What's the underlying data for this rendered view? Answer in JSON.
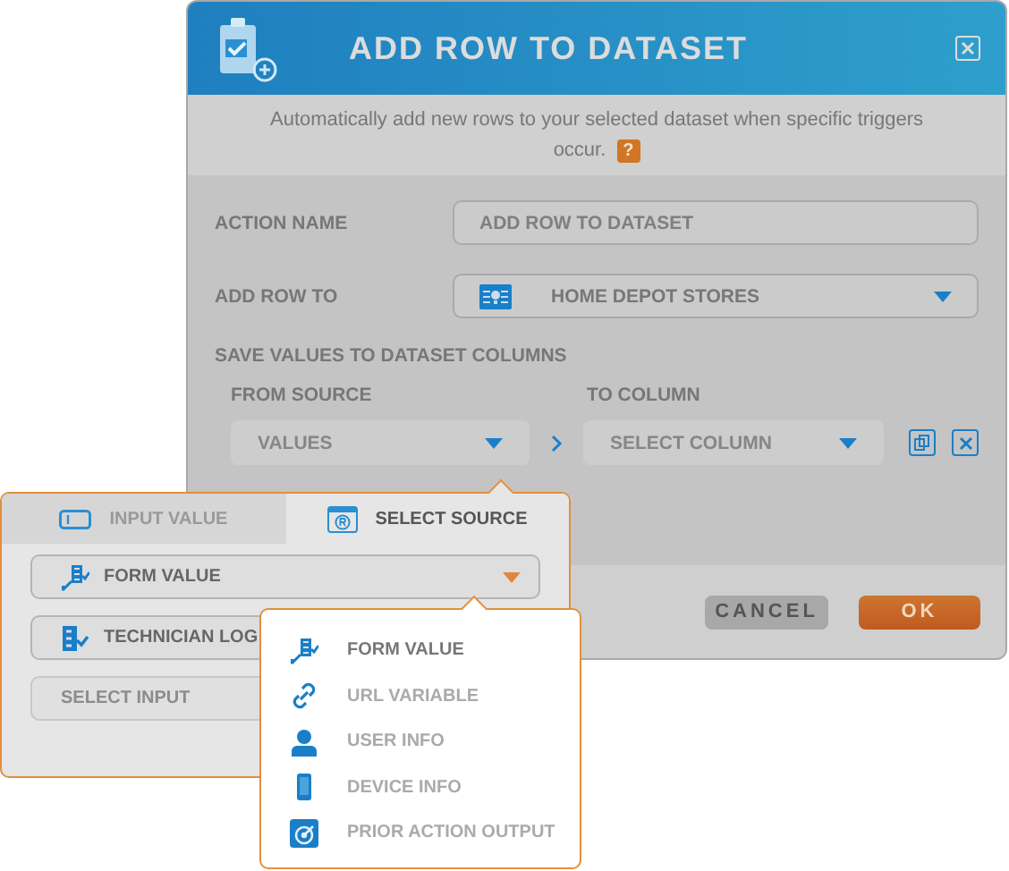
{
  "dialog": {
    "title": "ADD ROW TO DATASET",
    "description": "Automatically add new rows to your selected dataset when specific triggers occur.",
    "help": "?",
    "action_name": {
      "label": "ACTION NAME",
      "placeholder": "ADD ROW TO DATASET"
    },
    "add_row_to": {
      "label": "ADD ROW TO",
      "value": "HOME DEPOT STORES"
    },
    "section": "SAVE VALUES TO DATASET COLUMNS",
    "from_source": {
      "label": "FROM SOURCE",
      "placeholder": "VALUES"
    },
    "to_column": {
      "label": "TO COLUMN",
      "placeholder": "SELECT COLUMN"
    },
    "buttons": [
      {
        "label": "CANCEL",
        "kind": "secondary"
      },
      {
        "label": "OK",
        "kind": "primary"
      }
    ]
  },
  "source_popover": {
    "tabs": [
      {
        "label": "INPUT VALUE",
        "kind": "input",
        "selected": false
      },
      {
        "label": "SELECT SOURCE",
        "kind": "source",
        "selected": true
      }
    ],
    "source": {
      "value": "FORM VALUE"
    },
    "form": {
      "value": "TECHNICIAN LOG"
    },
    "input": {
      "placeholder": "SELECT INPUT"
    }
  },
  "source_menu": [
    {
      "label": "FORM VALUE",
      "kind": "form",
      "selected": true
    },
    {
      "label": "URL VARIABLE",
      "kind": "link",
      "selected": false
    },
    {
      "label": "USER INFO",
      "kind": "user",
      "selected": false
    },
    {
      "label": "DEVICE INFO",
      "kind": "device",
      "selected": false
    },
    {
      "label": "PRIOR ACTION OUTPUT",
      "kind": "output",
      "selected": false
    }
  ]
}
